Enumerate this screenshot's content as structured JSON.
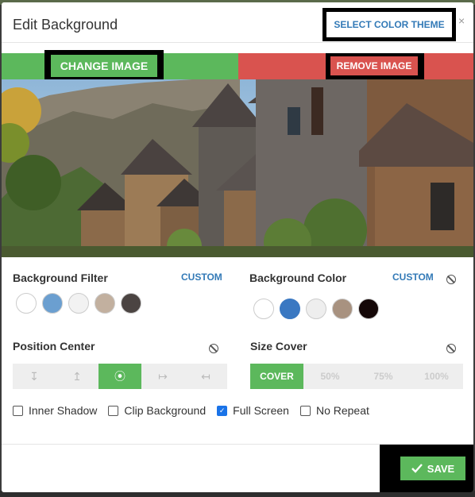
{
  "dialog": {
    "title": "Edit Background",
    "select_theme_label": "SELECT COLOR THEME",
    "close_glyph": "×"
  },
  "image_bar": {
    "change_label": "CHANGE IMAGE",
    "remove_label": "REMOVE IMAGE"
  },
  "filter": {
    "label": "Background Filter",
    "custom_label": "CUSTOM",
    "swatches": [
      "#ffffff",
      "#6b9fd0",
      "#f2f2f2",
      "#c2b09f",
      "#4b4442"
    ]
  },
  "color": {
    "label": "Background Color",
    "custom_label": "CUSTOM",
    "swatches": [
      "#ffffff",
      "#3a78c2",
      "#eeeeee",
      "#a89280",
      "#150808"
    ],
    "selected": "#3a78c2"
  },
  "position": {
    "label": "Position Center",
    "options": [
      "↧",
      "↥",
      "⦿",
      "↦",
      "↤"
    ],
    "selected_index": 2
  },
  "size": {
    "label": "Size Cover",
    "options": [
      "COVER",
      "50%",
      "75%",
      "100%"
    ],
    "selected_index": 0
  },
  "options": {
    "inner_shadow": {
      "label": "Inner Shadow",
      "checked": false
    },
    "clip_background": {
      "label": "Clip Background",
      "checked": false
    },
    "full_screen": {
      "label": "Full Screen",
      "checked": true
    },
    "no_repeat": {
      "label": "No Repeat",
      "checked": false
    }
  },
  "footer": {
    "save_label": "SAVE",
    "save_icon": "checkmark-icon"
  },
  "colors": {
    "green": "#5cb85c",
    "red": "#d9534f",
    "link_blue": "#337ab7"
  }
}
